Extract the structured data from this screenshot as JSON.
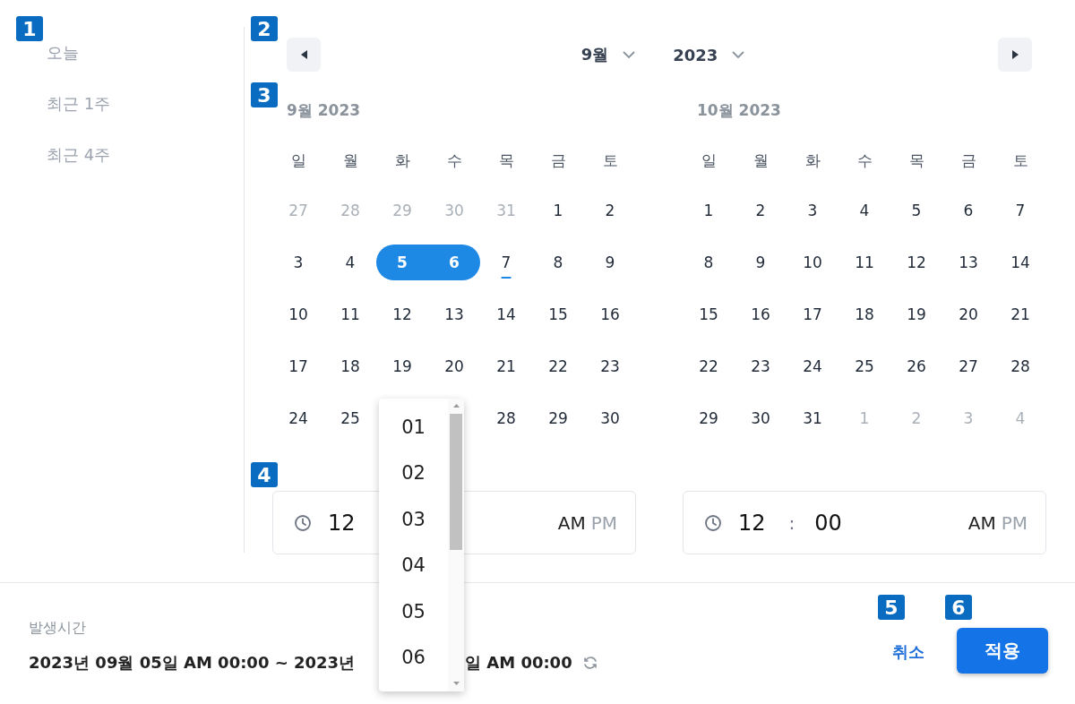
{
  "annotations": [
    {
      "label": "1"
    },
    {
      "label": "2"
    },
    {
      "label": "3"
    },
    {
      "label": "4"
    },
    {
      "label": "5"
    },
    {
      "label": "6"
    }
  ],
  "presets": [
    {
      "label": "오늘"
    },
    {
      "label": "최근 1주"
    },
    {
      "label": "최근 4주"
    }
  ],
  "nav": {
    "month": "9월",
    "year": "2023"
  },
  "calendars": [
    {
      "title": "9월 2023",
      "weekdays": [
        "일",
        "월",
        "화",
        "수",
        "목",
        "금",
        "토"
      ],
      "weeks": [
        [
          {
            "day": "27",
            "kind": "outside",
            "selected": false
          },
          {
            "day": "28",
            "kind": "outside",
            "selected": false
          },
          {
            "day": "29",
            "kind": "outside",
            "selected": false
          },
          {
            "day": "30",
            "kind": "outside",
            "selected": false
          },
          {
            "day": "31",
            "kind": "outside",
            "selected": false
          },
          {
            "day": "1",
            "kind": "normal",
            "selected": false
          },
          {
            "day": "2",
            "kind": "normal",
            "selected": false
          }
        ],
        [
          {
            "day": "3",
            "kind": "normal",
            "selected": false
          },
          {
            "day": "4",
            "kind": "normal",
            "selected": false
          },
          {
            "day": "5",
            "kind": "normal",
            "selected": true
          },
          {
            "day": "6",
            "kind": "normal",
            "selected": true
          },
          {
            "day": "7",
            "kind": "today",
            "selected": false
          },
          {
            "day": "8",
            "kind": "normal",
            "selected": false
          },
          {
            "day": "9",
            "kind": "normal",
            "selected": false
          }
        ],
        [
          {
            "day": "10",
            "kind": "normal",
            "selected": false
          },
          {
            "day": "11",
            "kind": "normal",
            "selected": false
          },
          {
            "day": "12",
            "kind": "normal",
            "selected": false
          },
          {
            "day": "13",
            "kind": "normal",
            "selected": false
          },
          {
            "day": "14",
            "kind": "normal",
            "selected": false
          },
          {
            "day": "15",
            "kind": "normal",
            "selected": false
          },
          {
            "day": "16",
            "kind": "normal",
            "selected": false
          }
        ],
        [
          {
            "day": "17",
            "kind": "normal",
            "selected": false
          },
          {
            "day": "18",
            "kind": "normal",
            "selected": false
          },
          {
            "day": "19",
            "kind": "normal",
            "selected": false
          },
          {
            "day": "20",
            "kind": "normal",
            "selected": false
          },
          {
            "day": "21",
            "kind": "normal",
            "selected": false
          },
          {
            "day": "22",
            "kind": "normal",
            "selected": false
          },
          {
            "day": "23",
            "kind": "normal",
            "selected": false
          }
        ],
        [
          {
            "day": "24",
            "kind": "normal",
            "selected": false
          },
          {
            "day": "25",
            "kind": "normal",
            "selected": false
          },
          {
            "kind": "covered"
          },
          {
            "kind": "covered"
          },
          {
            "day": "28",
            "kind": "normal",
            "selected": false
          },
          {
            "day": "29",
            "kind": "normal",
            "selected": false
          },
          {
            "day": "30",
            "kind": "normal",
            "selected": false
          }
        ]
      ]
    },
    {
      "title": "10월 2023",
      "weekdays": [
        "일",
        "월",
        "화",
        "수",
        "목",
        "금",
        "토"
      ],
      "weeks": [
        [
          {
            "day": "1",
            "kind": "normal",
            "selected": false
          },
          {
            "day": "2",
            "kind": "normal",
            "selected": false
          },
          {
            "day": "3",
            "kind": "normal",
            "selected": false
          },
          {
            "day": "4",
            "kind": "normal",
            "selected": false
          },
          {
            "day": "5",
            "kind": "normal",
            "selected": false
          },
          {
            "day": "6",
            "kind": "normal",
            "selected": false
          },
          {
            "day": "7",
            "kind": "normal",
            "selected": false
          }
        ],
        [
          {
            "day": "8",
            "kind": "normal",
            "selected": false
          },
          {
            "day": "9",
            "kind": "normal",
            "selected": false
          },
          {
            "day": "10",
            "kind": "normal",
            "selected": false
          },
          {
            "day": "11",
            "kind": "normal",
            "selected": false
          },
          {
            "day": "12",
            "kind": "normal",
            "selected": false
          },
          {
            "day": "13",
            "kind": "normal",
            "selected": false
          },
          {
            "day": "14",
            "kind": "normal",
            "selected": false
          }
        ],
        [
          {
            "day": "15",
            "kind": "normal",
            "selected": false
          },
          {
            "day": "16",
            "kind": "normal",
            "selected": false
          },
          {
            "day": "17",
            "kind": "normal",
            "selected": false
          },
          {
            "day": "18",
            "kind": "normal",
            "selected": false
          },
          {
            "day": "19",
            "kind": "normal",
            "selected": false
          },
          {
            "day": "20",
            "kind": "normal",
            "selected": false
          },
          {
            "day": "21",
            "kind": "normal",
            "selected": false
          }
        ],
        [
          {
            "day": "22",
            "kind": "normal",
            "selected": false
          },
          {
            "day": "23",
            "kind": "normal",
            "selected": false
          },
          {
            "day": "24",
            "kind": "normal",
            "selected": false
          },
          {
            "day": "25",
            "kind": "normal",
            "selected": false
          },
          {
            "day": "26",
            "kind": "normal",
            "selected": false
          },
          {
            "day": "27",
            "kind": "normal",
            "selected": false
          },
          {
            "day": "28",
            "kind": "normal",
            "selected": false
          }
        ],
        [
          {
            "day": "29",
            "kind": "normal",
            "selected": false
          },
          {
            "day": "30",
            "kind": "normal",
            "selected": false
          },
          {
            "day": "31",
            "kind": "normal",
            "selected": false
          },
          {
            "day": "1",
            "kind": "outside",
            "selected": false
          },
          {
            "day": "2",
            "kind": "outside",
            "selected": false
          },
          {
            "day": "3",
            "kind": "outside",
            "selected": false
          },
          {
            "day": "4",
            "kind": "outside",
            "selected": false
          }
        ]
      ]
    }
  ],
  "time_fields": [
    {
      "hour": "12",
      "meridiem": [
        {
          "label": "AM",
          "selected": true
        },
        {
          "label": "PM",
          "selected": false
        }
      ]
    },
    {
      "hour": "12",
      "separator": ":",
      "minute": "00",
      "meridiem": [
        {
          "label": "AM",
          "selected": true
        },
        {
          "label": "PM",
          "selected": false
        }
      ]
    }
  ],
  "footer": {
    "label": "발생시간",
    "summary": [
      "2023년 09월 05일 AM 00:00 ~ 2023년",
      "일 AM 00:00"
    ],
    "cancel": "취소",
    "apply": "적용"
  },
  "hour_dropdown": {
    "options": [
      "01",
      "02",
      "03",
      "04",
      "05",
      "06"
    ]
  }
}
